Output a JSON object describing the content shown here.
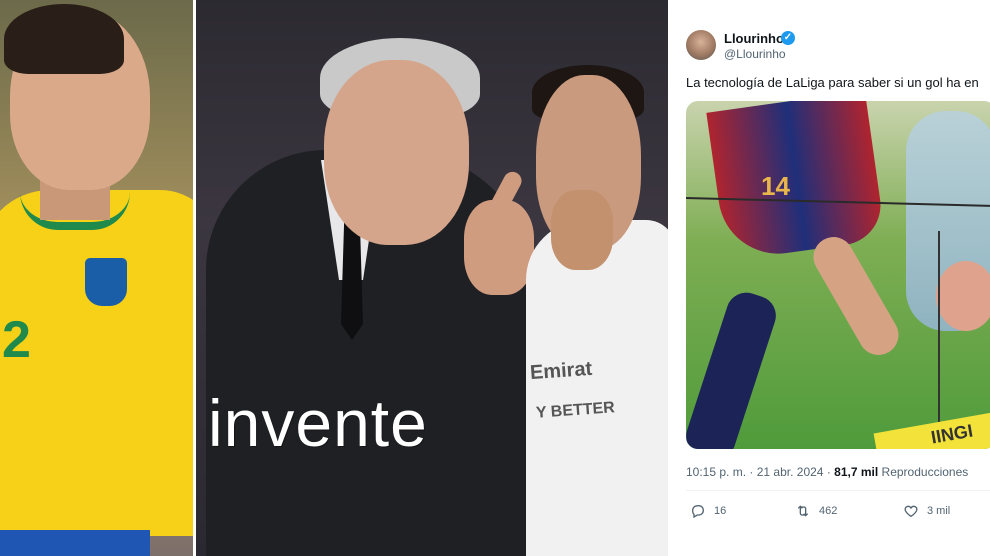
{
  "meme": {
    "caption": "invente"
  },
  "left_photo": {
    "jersey_number": "2"
  },
  "middle_photo": {
    "shirt_text_1": "Emirat",
    "shirt_text_2": "Y BETTER"
  },
  "tweet": {
    "author_name": "Llourinho",
    "verified_mark": "✓",
    "author_handle": "@Llourinho",
    "text": "La tecnología de LaLiga para saber si un gol ha en",
    "media": {
      "jersey_number": "14",
      "adboard_text": "IINGI"
    },
    "time": "10:15 p. m.",
    "date": "21 abr. 2024",
    "views_count": "81,7 mil",
    "views_label": "Reproducciones",
    "separator": "·",
    "actions": {
      "replies": "16",
      "retweets": "462",
      "likes": "3 mil"
    },
    "icons": [
      "reply-icon",
      "retweet-icon",
      "like-icon"
    ],
    "colors": {
      "verified": "#1d9bf0",
      "text": "#0f1419",
      "muted": "#536471"
    }
  }
}
